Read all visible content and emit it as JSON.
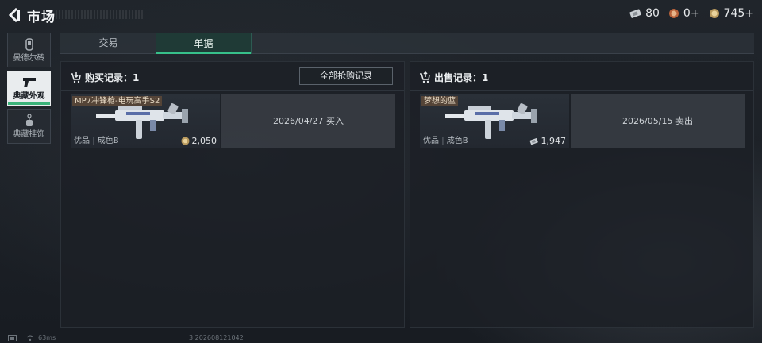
{
  "header": {
    "title": "市场"
  },
  "currencies": [
    {
      "icon": "ticket-icon",
      "value": "80"
    },
    {
      "icon": "badge-coin-icon",
      "value": "0+"
    },
    {
      "icon": "gold-coin-icon",
      "value": "745+"
    }
  ],
  "sidebar": {
    "items": [
      {
        "label": "曼德尔砖",
        "icon": "brick-icon",
        "active": false
      },
      {
        "label": "典藏外观",
        "icon": "pistol-icon",
        "active": true
      },
      {
        "label": "典藏挂饰",
        "icon": "charm-icon",
        "active": false
      }
    ]
  },
  "tabs": [
    {
      "label": "交易",
      "active": false
    },
    {
      "label": "单据",
      "active": true
    }
  ],
  "purchase": {
    "title": "购买记录：1",
    "all_button": "全部抢购记录",
    "records": [
      {
        "name": "MP7冲锋枪-电玩高手S2",
        "quality": "优品",
        "condition": "成色B",
        "price": "2,050",
        "price_icon": "gold-coin-icon",
        "detail": "2026/04/27 买入"
      }
    ]
  },
  "sale": {
    "title": "出售记录：1",
    "records": [
      {
        "name": "梦想的蓝",
        "quality": "优品",
        "condition": "成色B",
        "price": "1,947",
        "price_icon": "ticket-icon",
        "detail": "2026/05/15 卖出"
      }
    ]
  },
  "footer": {
    "ping": "63ms",
    "build": "3.202608121042"
  },
  "colors": {
    "accent": "#37c08a",
    "name_tag": "#785638"
  }
}
